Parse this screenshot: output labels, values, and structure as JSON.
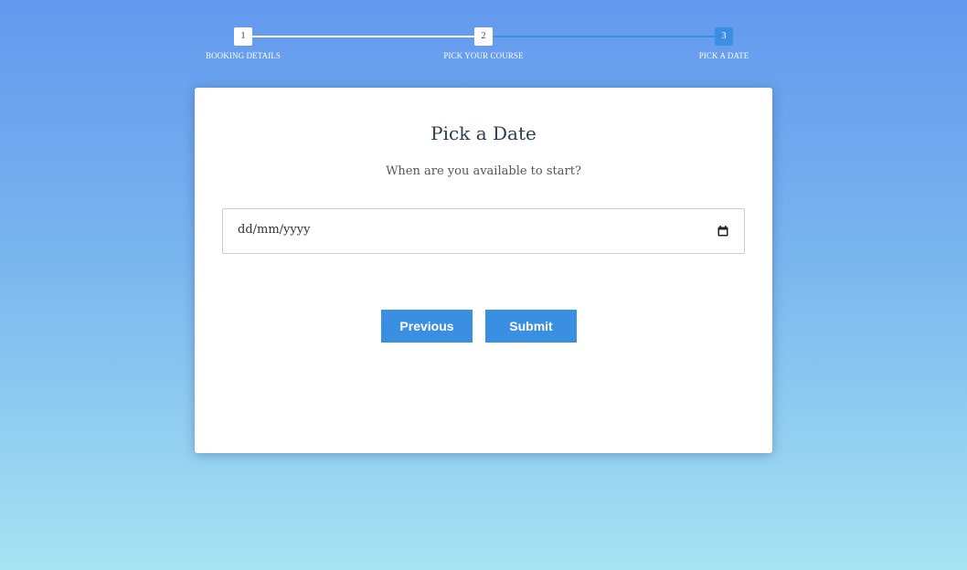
{
  "colors": {
    "background_top": "#6399ee",
    "background_bottom": "#a6e3f2",
    "accent": "#3b8fe3",
    "card": "#ffffff"
  },
  "stepper": {
    "current_step": 3,
    "steps": [
      {
        "number": "1",
        "label": "BOOKING DETAILS"
      },
      {
        "number": "2",
        "label": "PICK YOUR COURSE"
      },
      {
        "number": "3",
        "label": "PICK A DATE"
      }
    ]
  },
  "form": {
    "title": "Pick a Date",
    "subtitle": "When are you available to start?",
    "date_input": {
      "placeholder": "dd/mm/yyyy",
      "icon": "calendar-icon"
    },
    "buttons": {
      "previous_label": "Previous",
      "submit_label": "Submit"
    }
  }
}
